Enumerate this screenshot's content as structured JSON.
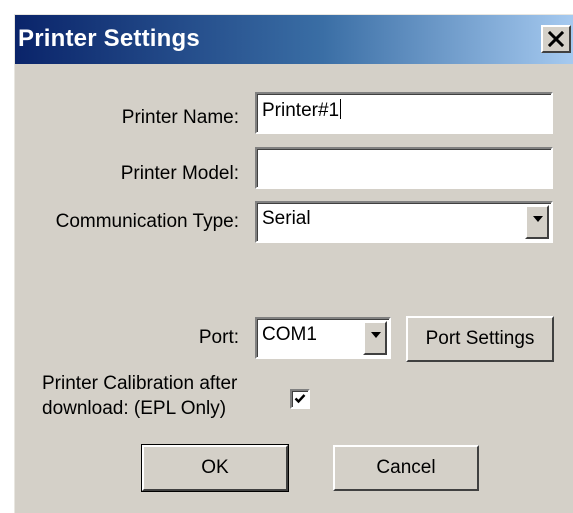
{
  "window": {
    "title": "Printer Settings",
    "close_label": "×"
  },
  "form": {
    "printer_name": {
      "label": "Printer Name:",
      "value": "Printer#1"
    },
    "printer_model": {
      "label": "Printer Model:",
      "value": ""
    },
    "communication_type": {
      "label": "Communication Type:",
      "value": "Serial"
    },
    "port": {
      "label": "Port:",
      "value": "COM1"
    },
    "port_settings_label": "Port Settings",
    "calibration": {
      "label_line1": "Printer Calibration after",
      "label_line2": "download: (EPL Only)",
      "checked": true
    }
  },
  "actions": {
    "ok_label": "OK",
    "cancel_label": "Cancel"
  },
  "icons": {
    "close": "close-icon",
    "dropdown": "chevron-down-icon",
    "check": "check-icon"
  },
  "colors": {
    "titlebar_start": "#0a246a",
    "titlebar_end": "#a6caf0",
    "face": "#d4d0c8"
  }
}
